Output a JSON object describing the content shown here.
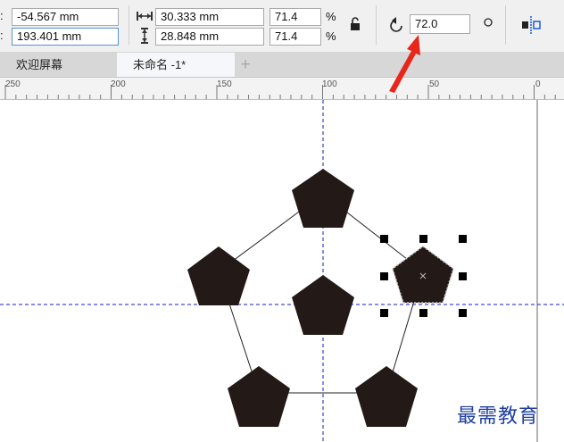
{
  "properties_bar": {
    "pos_x": "-54.567 mm",
    "pos_y": "193.401 mm",
    "width": "30.333 mm",
    "height": "28.848 mm",
    "scale_x": "71.4",
    "scale_y": "71.4",
    "percent": "%",
    "rotation": "72.0",
    "colon": ":"
  },
  "tabs": [
    {
      "label": "欢迎屏幕"
    },
    {
      "label": "未命名 -1*"
    }
  ],
  "new_tab_label": "+",
  "ruler": {
    "labels": [
      "250",
      "200",
      "150",
      "100",
      "50",
      "0"
    ]
  },
  "watermark": "最需教育",
  "colors": {
    "shape_fill": "#231916",
    "guide": "#1a1acc",
    "arrow": "#e8271b",
    "watermark": "#1f3fa0"
  }
}
